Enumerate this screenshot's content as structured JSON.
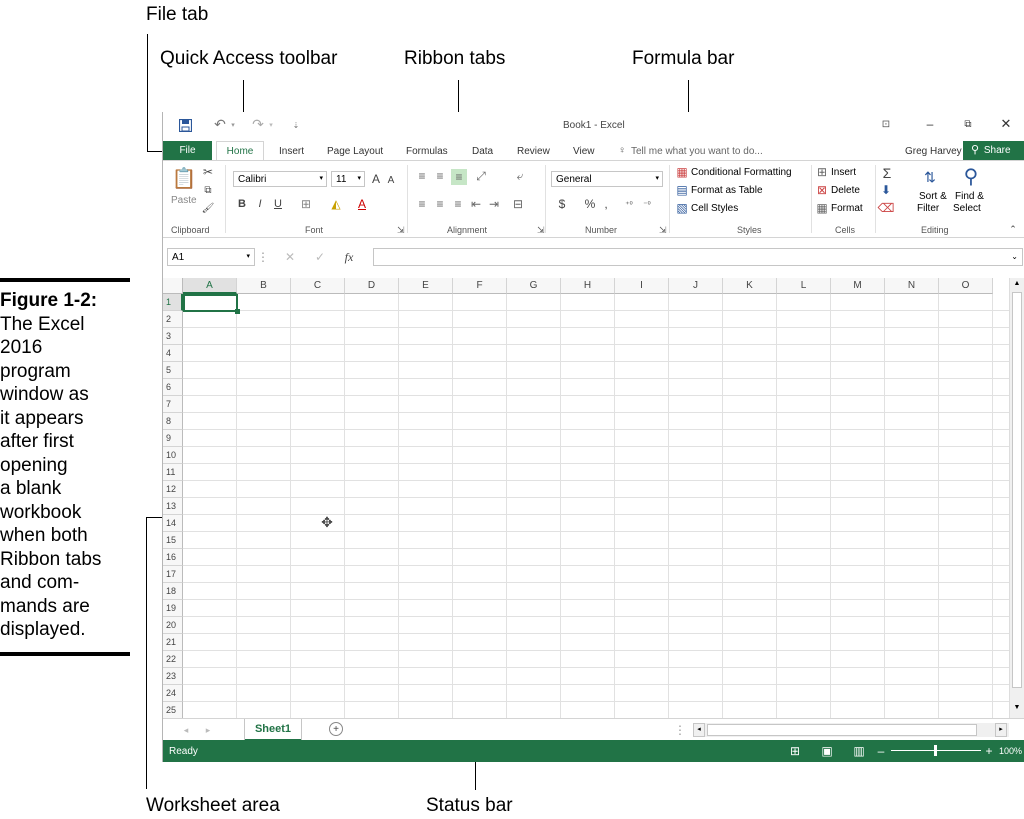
{
  "annotations": {
    "file_tab": "File tab",
    "quick_access_toolbar": "Quick Access toolbar",
    "ribbon_tabs": "Ribbon tabs",
    "formula_bar": "Formula bar",
    "worksheet_area": "Worksheet area",
    "status_bar": "Status bar"
  },
  "caption": {
    "figure": "Figure 1-2:",
    "lines": [
      "The Excel",
      "2016",
      "program",
      "window as",
      "it appears",
      "after first",
      "opening",
      "a blank",
      "workbook",
      "when both",
      "Ribbon tabs",
      "and com-",
      "mands are",
      "displayed."
    ]
  },
  "window": {
    "title": "Book1 - Excel",
    "user": "Greg Harvey",
    "share": "Share",
    "tell_me": "Tell me what you want to do..."
  },
  "tabs": [
    "File",
    "Home",
    "Insert",
    "Page Layout",
    "Formulas",
    "Data",
    "Review",
    "View"
  ],
  "ribbon": {
    "paste": "Paste",
    "font_name": "Calibri",
    "font_size": "11",
    "number_format": "General",
    "conditional_formatting": "Conditional Formatting",
    "format_as_table": "Format as Table",
    "cell_styles": "Cell Styles",
    "insert": "Insert",
    "delete": "Delete",
    "format": "Format",
    "sort_filter_1": "Sort &",
    "sort_filter_2": "Filter",
    "find_select_1": "Find &",
    "find_select_2": "Select",
    "groups": {
      "clipboard": "Clipboard",
      "font": "Font",
      "alignment": "Alignment",
      "number": "Number",
      "styles": "Styles",
      "cells": "Cells",
      "editing": "Editing"
    }
  },
  "formula_bar": {
    "name_box": "A1",
    "fx": "fx",
    "content": ""
  },
  "columns": [
    "A",
    "B",
    "C",
    "D",
    "E",
    "F",
    "G",
    "H",
    "I",
    "J",
    "K",
    "L",
    "M",
    "N",
    "O"
  ],
  "rows": [
    "1",
    "2",
    "3",
    "4",
    "5",
    "6",
    "7",
    "8",
    "9",
    "10",
    "11",
    "12",
    "13",
    "14",
    "15",
    "16",
    "17",
    "18",
    "19",
    "20",
    "21",
    "22",
    "23",
    "24",
    "25"
  ],
  "sheet": {
    "name": "Sheet1"
  },
  "status": {
    "text": "Ready",
    "zoom": "100%"
  },
  "colors": {
    "excel_green": "#217346",
    "file_tab": "#217346",
    "selected_cell": "#217346"
  }
}
